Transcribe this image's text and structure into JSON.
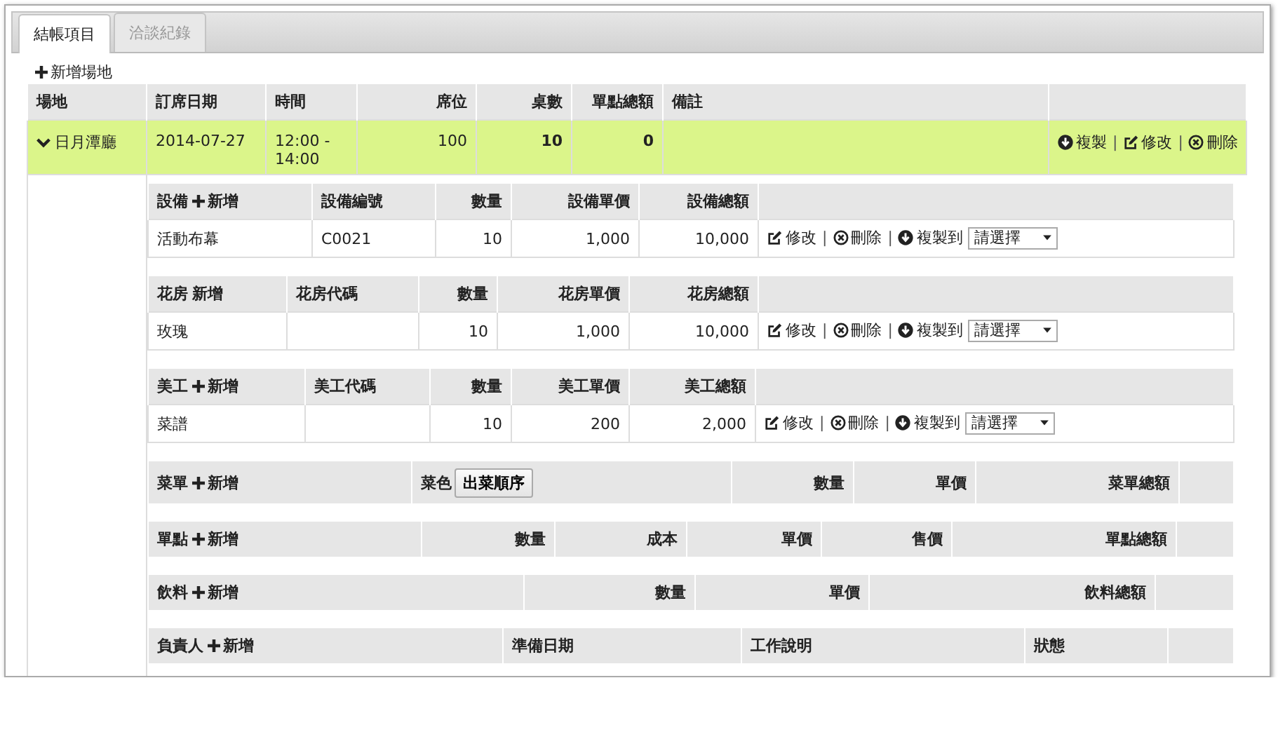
{
  "tabs": [
    {
      "label": "結帳項目",
      "selected": true
    },
    {
      "label": "洽談紀錄",
      "selected": false
    }
  ],
  "add_venue": {
    "label": "新增場地"
  },
  "venue_table": {
    "columns": [
      {
        "label": "場地",
        "kind": "text"
      },
      {
        "label": "訂席日期",
        "kind": "text"
      },
      {
        "label": "時間",
        "kind": "text"
      },
      {
        "label": "席位",
        "kind": "number"
      },
      {
        "label": "桌數",
        "kind": "total"
      },
      {
        "label": "單點總額",
        "kind": "total"
      },
      {
        "label": "備註",
        "kind": "text"
      }
    ],
    "rows": [
      {
        "expanded": true,
        "cells": [
          "日月潭廳",
          "2014-07-27",
          "12:00 - 14:00",
          "100",
          "10",
          "0"
        ],
        "actions": [
          {
            "kind": "copy",
            "label": "複製"
          },
          {
            "kind": "separator",
            "label": "|"
          },
          {
            "kind": "edit",
            "label": "修改"
          },
          {
            "kind": "separator",
            "label": "|"
          },
          {
            "kind": "delete",
            "label": "刪除"
          }
        ]
      }
    ]
  },
  "sections": [
    {
      "columns": [
        {
          "kind": "title",
          "label": "設備",
          "add": {
            "label": "新增",
            "icon": true
          }
        },
        {
          "label": "設備編號",
          "kind": "text"
        },
        {
          "label": "數量",
          "kind": "number"
        },
        {
          "label": "設備單價",
          "kind": "number"
        },
        {
          "label": "設備總額",
          "kind": "number"
        }
      ],
      "rows": [
        {
          "cells": [
            "活動布幕",
            "C0021",
            "10",
            "1,000",
            "10,000"
          ],
          "actions": [
            {
              "kind": "edit",
              "label": "修改"
            },
            {
              "kind": "separator",
              "label": "|"
            },
            {
              "kind": "delete",
              "label": "刪除"
            },
            {
              "kind": "separator",
              "label": "|"
            },
            {
              "kind": "copy_to",
              "label": "複製到",
              "value": "請選擇"
            }
          ]
        }
      ]
    },
    {
      "columns": [
        {
          "kind": "title",
          "label": "花房",
          "add": {
            "label": "新增",
            "icon": false
          }
        },
        {
          "label": "花房代碼",
          "kind": "text"
        },
        {
          "label": "數量",
          "kind": "number"
        },
        {
          "label": "花房單價",
          "kind": "number"
        },
        {
          "label": "花房總額",
          "kind": "number"
        }
      ],
      "rows": [
        {
          "cells": [
            "玫瑰",
            "",
            "10",
            "1,000",
            "10,000"
          ],
          "actions": [
            {
              "kind": "edit",
              "label": "修改"
            },
            {
              "kind": "separator",
              "label": "|"
            },
            {
              "kind": "delete",
              "label": "刪除"
            },
            {
              "kind": "separator",
              "label": "|"
            },
            {
              "kind": "copy_to",
              "label": "複製到",
              "value": "請選擇"
            }
          ]
        }
      ]
    },
    {
      "columns": [
        {
          "kind": "title",
          "label": "美工",
          "add": {
            "label": "新增",
            "icon": true
          }
        },
        {
          "label": "美工代碼",
          "kind": "text"
        },
        {
          "label": "數量",
          "kind": "number"
        },
        {
          "label": "美工單價",
          "kind": "number"
        },
        {
          "label": "美工總額",
          "kind": "number"
        }
      ],
      "rows": [
        {
          "cells": [
            "菜譜",
            "",
            "10",
            "200",
            "2,000"
          ],
          "actions": [
            {
              "kind": "edit",
              "label": "修改"
            },
            {
              "kind": "separator",
              "label": "|"
            },
            {
              "kind": "delete",
              "label": "刪除"
            },
            {
              "kind": "separator",
              "label": "|"
            },
            {
              "kind": "copy_to",
              "label": "複製到",
              "value": "請選擇"
            }
          ]
        }
      ]
    },
    {
      "columns": [
        {
          "kind": "title",
          "label": "菜單",
          "add": {
            "label": "新增",
            "icon": true
          }
        },
        {
          "label": "菜色",
          "kind": "text",
          "button": "出菜順序"
        },
        {
          "label": "數量",
          "kind": "number"
        },
        {
          "label": "單價",
          "kind": "number"
        },
        {
          "label": "菜單總額",
          "kind": "number"
        }
      ]
    },
    {
      "columns": [
        {
          "kind": "title",
          "label": "單點",
          "add": {
            "label": "新增",
            "icon": true
          }
        },
        {
          "label": "數量",
          "kind": "number"
        },
        {
          "label": "成本",
          "kind": "number"
        },
        {
          "label": "單價",
          "kind": "number"
        },
        {
          "label": "售價",
          "kind": "number"
        },
        {
          "label": "單點總額",
          "kind": "number"
        }
      ]
    },
    {
      "columns": [
        {
          "kind": "title",
          "label": "飲料",
          "add": {
            "label": "新增",
            "icon": true
          }
        },
        {
          "label": "數量",
          "kind": "number"
        },
        {
          "label": "單價",
          "kind": "number"
        },
        {
          "label": "飲料總額",
          "kind": "number"
        }
      ]
    },
    {
      "columns": [
        {
          "kind": "title",
          "label": "負責人",
          "add": {
            "label": "新增",
            "icon": true
          }
        },
        {
          "label": "準備日期",
          "kind": "text"
        },
        {
          "label": "工作說明",
          "kind": "text"
        },
        {
          "label": "狀態",
          "kind": "text"
        }
      ]
    }
  ]
}
